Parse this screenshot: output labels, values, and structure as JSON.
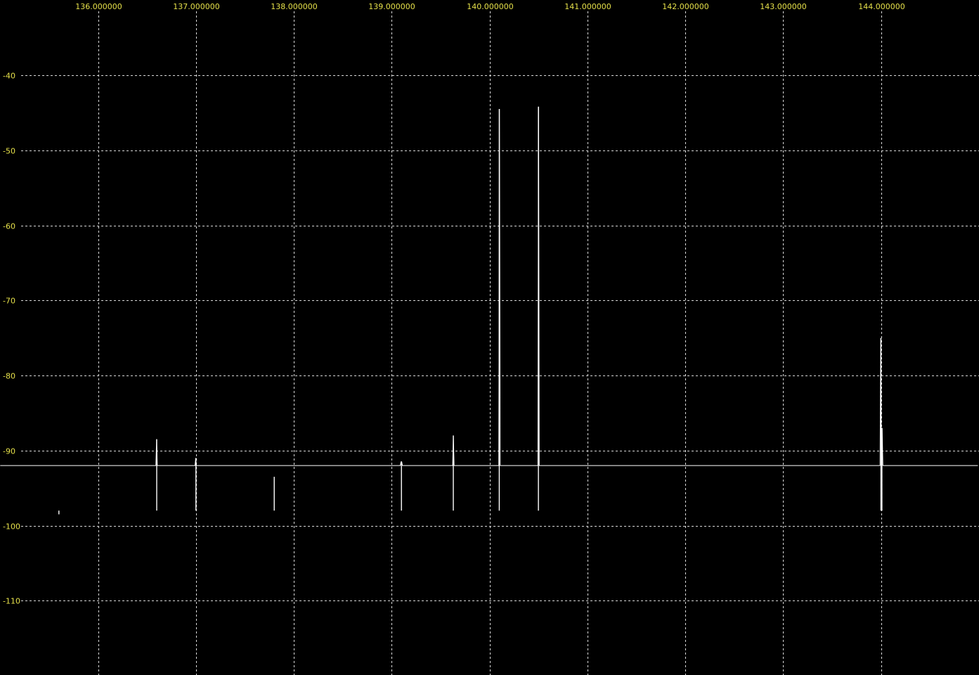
{
  "colors": {
    "background": "#000000",
    "grid": "#d8d8d8",
    "label": "#e6e14a",
    "trace": "#ffffff"
  },
  "chart_data": {
    "type": "line",
    "title": "",
    "xlabel": "",
    "ylabel": "",
    "xlim": [
      135.0,
      145.0
    ],
    "ylim": [
      -120,
      -30
    ],
    "grid": true,
    "x_ticks": [
      136,
      137,
      138,
      139,
      140,
      141,
      142,
      143,
      144
    ],
    "x_tick_labels": [
      "136.000000",
      "137.000000",
      "138.000000",
      "139.000000",
      "140.000000",
      "141.000000",
      "142.000000",
      "143.000000",
      "144.000000"
    ],
    "y_ticks": [
      -40,
      -50,
      -60,
      -70,
      -80,
      -90,
      -100,
      -110
    ],
    "y_tick_labels": [
      "-40",
      "-50",
      "-60",
      "-70",
      "-80",
      "-90",
      "-100",
      "-110"
    ],
    "series": [
      {
        "noise_floor": -98,
        "noise_range": [
          -101,
          -94
        ],
        "x_range": [
          135.0,
          144.99
        ],
        "peaks": [
          {
            "x": 135.6,
            "y": -98.5
          },
          {
            "x": 136.6,
            "y": -88.5
          },
          {
            "x": 137.0,
            "y": -91.0
          },
          {
            "x": 137.8,
            "y": -93.5
          },
          {
            "x": 139.1,
            "y": -91.5
          },
          {
            "x": 139.63,
            "y": -88.0
          },
          {
            "x": 140.1,
            "y": -44.5
          },
          {
            "x": 140.5,
            "y": -44.2
          },
          {
            "x": 144.0,
            "y": -75.0
          },
          {
            "x": 144.01,
            "y": -87.0
          }
        ]
      }
    ]
  }
}
